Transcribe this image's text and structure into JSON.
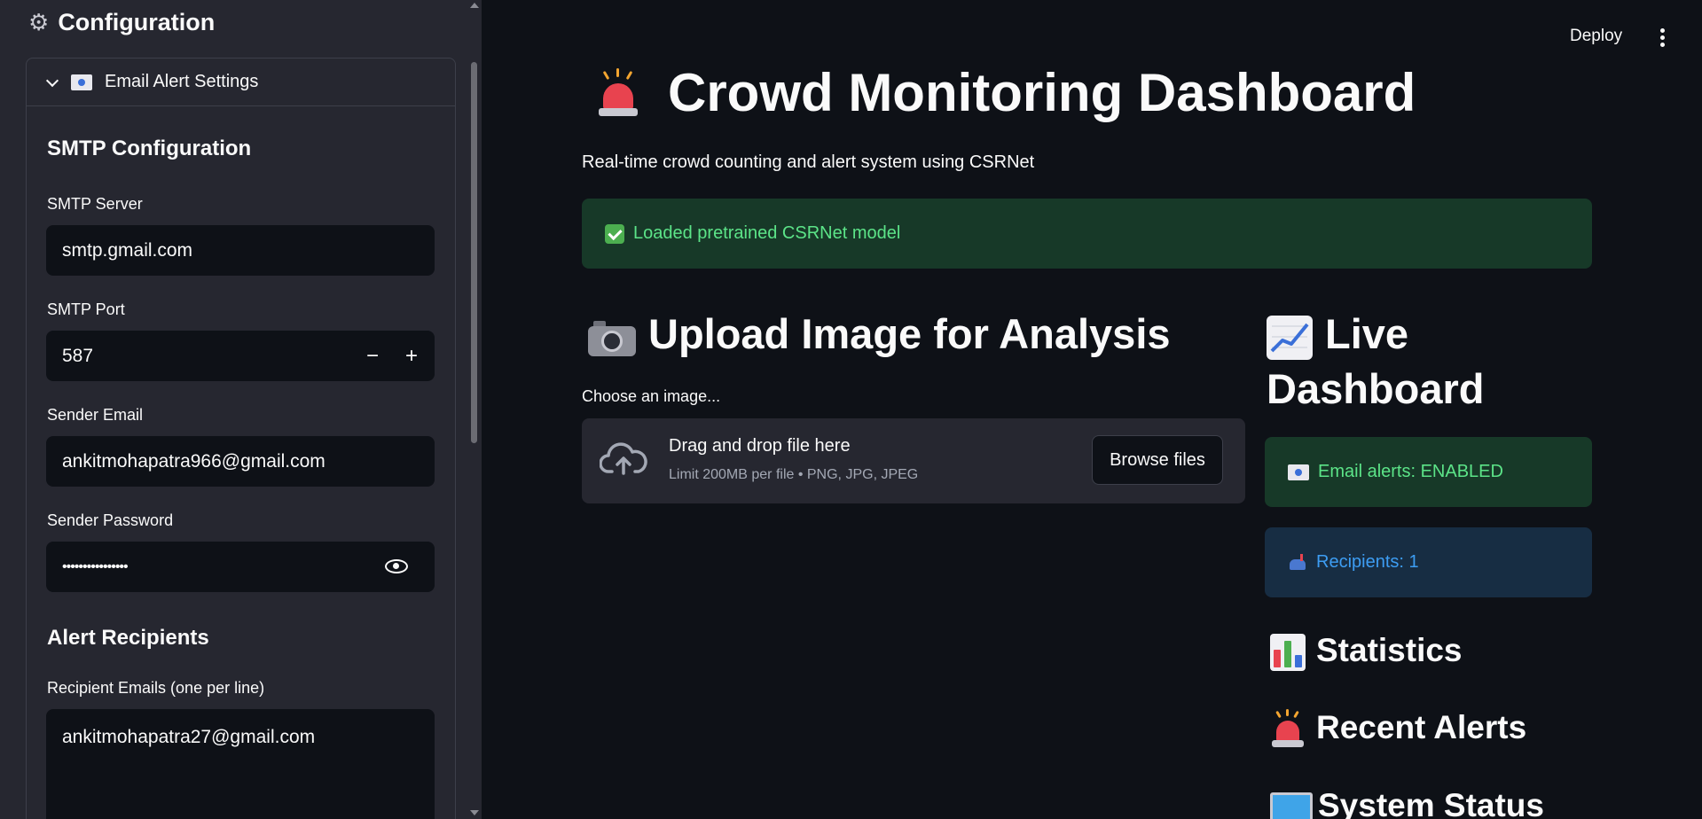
{
  "sidebar": {
    "title": "Configuration",
    "expander_label": "Email Alert Settings",
    "smtp_section": "SMTP Configuration",
    "smtp_server_label": "SMTP Server",
    "smtp_server_value": "smtp.gmail.com",
    "smtp_port_label": "SMTP Port",
    "smtp_port_value": "587",
    "stepper_minus": "−",
    "stepper_plus": "+",
    "sender_email_label": "Sender Email",
    "sender_email_value": "ankitmohapatra966@gmail.com",
    "sender_password_label": "Sender Password",
    "sender_password_value": "••••••••••••••••",
    "recipients_section": "Alert Recipients",
    "recipient_emails_label": "Recipient Emails (one per line)",
    "recipient_emails_value": "ankitmohapatra27@gmail.com"
  },
  "toolbar": {
    "deploy_label": "Deploy"
  },
  "main": {
    "title": "Crowd Monitoring Dashboard",
    "subtitle": "Real-time crowd counting and alert system using CSRNet",
    "model_status": "Loaded pretrained CSRNet model",
    "upload_heading": "Upload Image for Analysis",
    "uploader_label": "Choose an image...",
    "dropzone_title": "Drag and drop file here",
    "dropzone_limit": "Limit 200MB per file • PNG, JPG, JPEG",
    "browse_label": "Browse files"
  },
  "dashboard": {
    "heading_line1": "Live",
    "heading_line2": "Dashboard",
    "email_status": "Email alerts: ENABLED",
    "recipients_status": "Recipients: 1",
    "statistics_heading": "Statistics",
    "recent_alerts_heading": "Recent Alerts",
    "system_status_heading": "System Status"
  },
  "colors": {
    "background": "#0e1117",
    "sidebar": "#262730",
    "success_bg": "#173928",
    "success_text": "#5ce488",
    "info_bg": "#172d43",
    "info_text": "#3d9df3"
  }
}
